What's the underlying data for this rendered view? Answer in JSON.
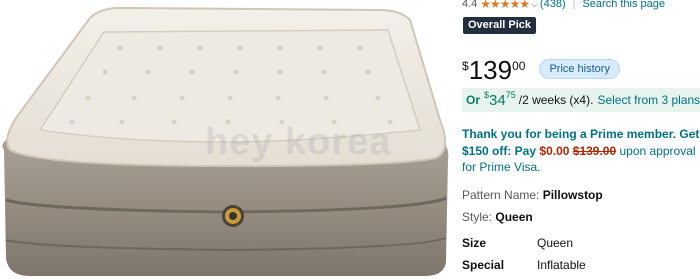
{
  "rating": {
    "value": "4.4",
    "stars": "★★★★★",
    "count": "(438)",
    "search_link": "Search this page"
  },
  "badge": "Overall Pick",
  "price": {
    "currency": "$",
    "whole": "139",
    "fraction": "00",
    "history_button": "Price history"
  },
  "installment": {
    "or": "Or",
    "currency": "$",
    "whole": "34",
    "fraction": "75",
    "period": "/2 weeks (x4).",
    "select": "Select from 3 plans"
  },
  "prime": {
    "line1": "Thank you for being a Prime member. Get",
    "offer": "$150 off: Pay",
    "new_price": "$0.00",
    "old_price": "$139.00",
    "rest": "upon approval for",
    "card": "Prime Visa."
  },
  "variation": {
    "pattern_label": "Pattern Name:",
    "pattern_value": "Pillowstop",
    "style_label": "Style:",
    "style_value": "Queen"
  },
  "specs": [
    {
      "label": "Size",
      "value": "Queen"
    },
    {
      "label": "Special",
      "value": "Inflatable"
    }
  ],
  "image": {
    "watermark": "hey korea"
  },
  "colors": {
    "link": "#007185",
    "deal_green": "#067d62",
    "price_red": "#b12704",
    "badge_bg": "#232f3e"
  }
}
